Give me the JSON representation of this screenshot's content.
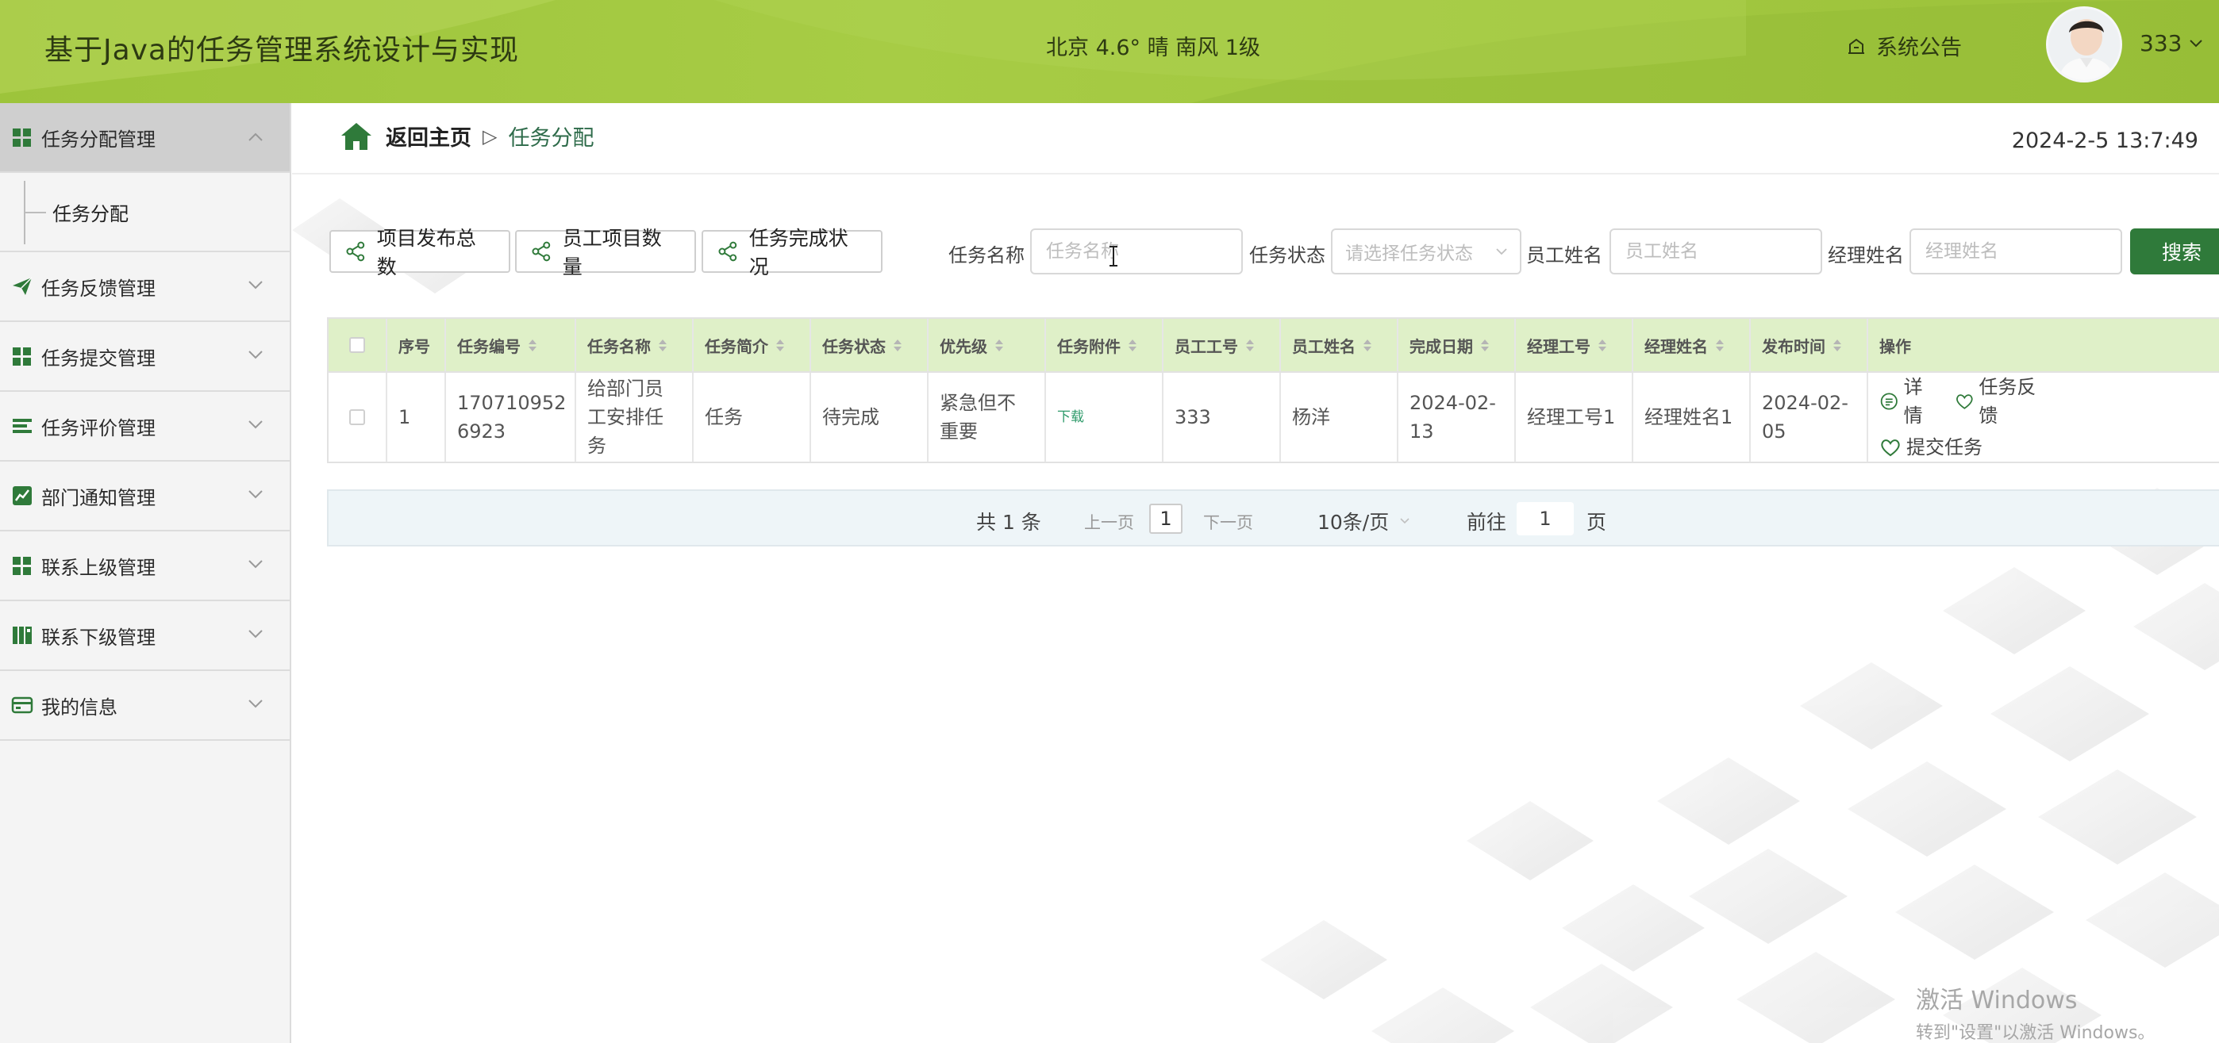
{
  "header": {
    "title": "基于Java的任务管理系统设计与实现",
    "weather": "北京 4.6° 晴 南风 1级",
    "notice_label": "系统公告",
    "username": "333"
  },
  "sidebar": {
    "items": [
      {
        "label": "任务分配管理",
        "icon": "grid-icon",
        "expanded": true,
        "children": [
          {
            "label": "任务分配"
          }
        ]
      },
      {
        "label": "任务反馈管理",
        "icon": "send-icon"
      },
      {
        "label": "任务提交管理",
        "icon": "grid-icon"
      },
      {
        "label": "任务评价管理",
        "icon": "list-icon"
      },
      {
        "label": "部门通知管理",
        "icon": "chart-icon"
      },
      {
        "label": "联系上级管理",
        "icon": "grid-icon"
      },
      {
        "label": "联系下级管理",
        "icon": "book-icon"
      },
      {
        "label": "我的信息",
        "icon": "card-icon"
      }
    ]
  },
  "breadcrumb": {
    "home": "返回主页",
    "separator": "▷",
    "current": "任务分配"
  },
  "datetime": "2024-2-5 13:7:49",
  "toolbar": {
    "buttons": [
      "项目发布总数",
      "员工项目数量",
      "任务完成状况"
    ],
    "filters": {
      "task_name_label": "任务名称",
      "task_name_placeholder": "任务名称",
      "task_status_label": "任务状态",
      "task_status_placeholder": "请选择任务状态",
      "employee_name_label": "员工姓名",
      "employee_name_placeholder": "员工姓名",
      "manager_name_label": "经理姓名",
      "manager_name_placeholder": "经理姓名"
    },
    "search_label": "搜索"
  },
  "table": {
    "columns": [
      "序号",
      "任务编号",
      "任务名称",
      "任务简介",
      "任务状态",
      "优先级",
      "任务附件",
      "员工工号",
      "员工姓名",
      "完成日期",
      "经理工号",
      "经理姓名",
      "发布时间",
      "操作"
    ],
    "rows": [
      {
        "index": "1",
        "task_no_l1": "170710952",
        "task_no_l2": "6923",
        "name_l1": "给部门员",
        "name_l2": "工安排任",
        "name_l3": "务",
        "intro": "任务",
        "status": "待完成",
        "priority_l1": "紧急但不",
        "priority_l2": "重要",
        "attachment": "下载",
        "emp_no": "333",
        "emp_name": "杨洋",
        "finish_l1": "2024-02-",
        "finish_l2": "13",
        "mgr_no": "经理工号1",
        "mgr_name": "经理姓名1",
        "publish_l1": "2024-02-",
        "publish_l2": "05",
        "ops": {
          "detail": "详情",
          "feedback": "任务反馈",
          "submit": "提交任务"
        }
      }
    ]
  },
  "pagination": {
    "total": "共 1 条",
    "prev": "上一页",
    "current_page": "1",
    "next": "下一页",
    "page_size": "10条/页",
    "goto_label": "前往",
    "goto_value": "1",
    "page_unit": "页"
  },
  "watermark": {
    "line1": "激活 Windows",
    "line2": "转到\"设置\"以激活 Windows。"
  }
}
